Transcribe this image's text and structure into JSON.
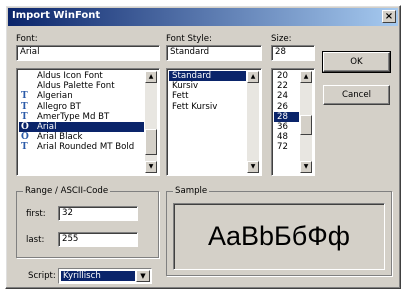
{
  "window": {
    "title": "Import WinFont",
    "close_icon": "×"
  },
  "font": {
    "label": "Font:",
    "value": "Arial",
    "items": [
      {
        "label": "Aldus Icon Font",
        "icon": ""
      },
      {
        "label": "Aldus Palette Font",
        "icon": ""
      },
      {
        "label": "Algerian",
        "icon": "T"
      },
      {
        "label": "Allegro BT",
        "icon": "T"
      },
      {
        "label": "AmerType Md BT",
        "icon": "T"
      },
      {
        "label": "Arial",
        "icon": "O",
        "selected": true
      },
      {
        "label": "Arial Black",
        "icon": "O"
      },
      {
        "label": "Arial Rounded MT Bold",
        "icon": "T"
      }
    ]
  },
  "style": {
    "label": "Font Style:",
    "value": "Standard",
    "items": [
      {
        "label": "Standard",
        "selected": true
      },
      {
        "label": "Kursiv"
      },
      {
        "label": "Fett"
      },
      {
        "label": "Fett Kursiv"
      }
    ]
  },
  "size": {
    "label": "Size:",
    "value": "28",
    "items": [
      {
        "label": "20"
      },
      {
        "label": "22"
      },
      {
        "label": "24"
      },
      {
        "label": "26"
      },
      {
        "label": "28",
        "selected": true
      },
      {
        "label": "36"
      },
      {
        "label": "48"
      },
      {
        "label": "72"
      }
    ]
  },
  "buttons": {
    "ok": "OK",
    "cancel": "Cancel"
  },
  "range": {
    "title": "Range / ASCII-Code",
    "first_label": "first:",
    "first_value": "32",
    "last_label": "last:",
    "last_value": "255"
  },
  "sample": {
    "title": "Sample",
    "text": "AaBbБбФф"
  },
  "script": {
    "label": "Script:",
    "value": "Kyrillisch"
  }
}
